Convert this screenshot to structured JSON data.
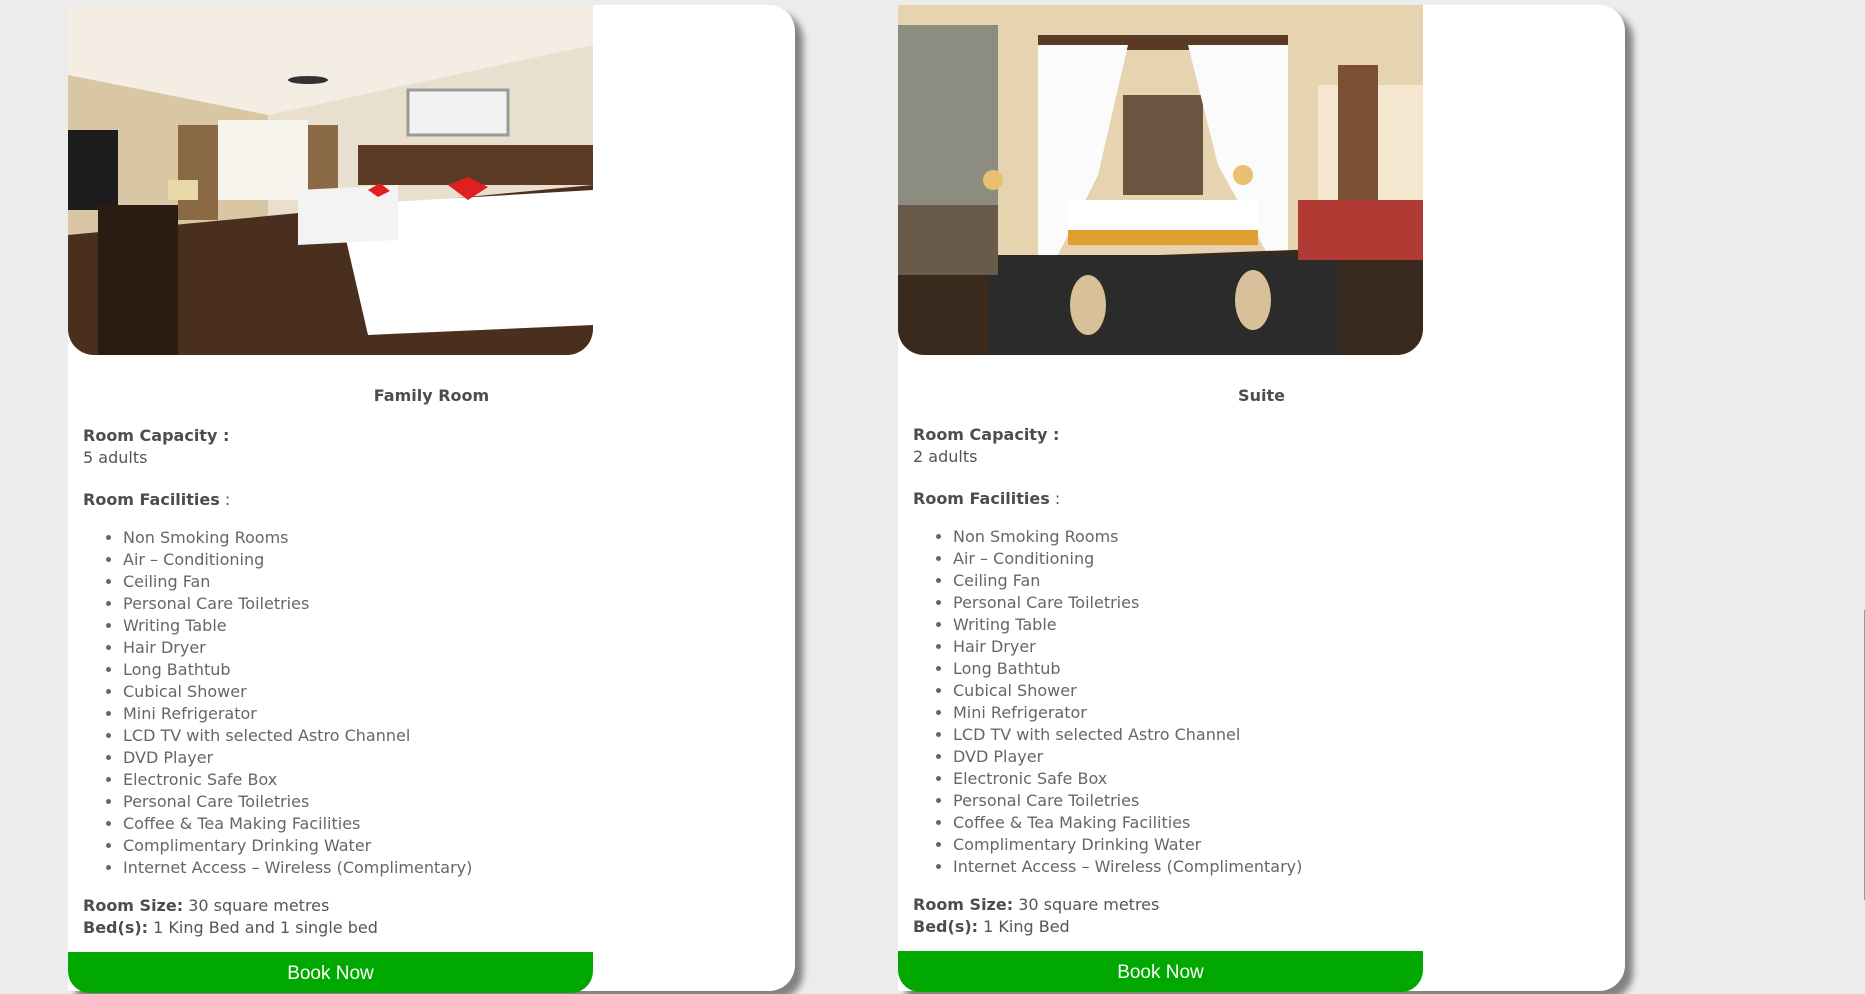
{
  "rooms": [
    {
      "name": "Family Room",
      "capacity_label": "Room Capacity :",
      "capacity_value": "5 adults",
      "facilities_label": "Room Facilities",
      "facilities_colon": " :",
      "facilities": [
        "Non Smoking Rooms",
        "Air – Conditioning",
        "Ceiling Fan",
        "Personal Care Toiletries",
        "Writing Table",
        "Hair Dryer",
        "Long Bathtub",
        "Cubical Shower",
        "Mini Refrigerator",
        "LCD TV with selected Astro Channel",
        "DVD Player",
        "Electronic Safe Box",
        "Personal Care Toiletries",
        "Coffee & Tea Making Facilities",
        "Complimentary Drinking Water",
        "Internet Access – Wireless (Complimentary)"
      ],
      "size_label": "Room Size:",
      "size_value": " 30 square metres",
      "beds_label": "Bed(s):",
      "beds_value": " 1 King Bed and 1 single bed",
      "button": "Book Now"
    },
    {
      "name": "Suite",
      "capacity_label": "Room Capacity :",
      "capacity_value": "2 adults",
      "facilities_label": "Room Facilities",
      "facilities_colon": " :",
      "facilities": [
        "Non Smoking Rooms",
        "Air – Conditioning",
        "Ceiling Fan",
        "Personal Care Toiletries",
        "Writing Table",
        "Hair Dryer",
        "Long Bathtub",
        "Cubical Shower",
        "Mini Refrigerator",
        "LCD TV with selected Astro Channel",
        "DVD Player",
        "Electronic Safe Box",
        "Personal Care Toiletries",
        "Coffee & Tea Making Facilities",
        "Complimentary Drinking Water",
        "Internet Access – Wireless (Complimentary)"
      ],
      "size_label": "Room Size:",
      "size_value": " 30 square metres",
      "beds_label": "Bed(s):",
      "beds_value": " 1 King Bed",
      "button": "Book Now"
    }
  ],
  "colors": {
    "button": "#00a800",
    "card": "#ffffff",
    "page_bg": "#ececec"
  }
}
